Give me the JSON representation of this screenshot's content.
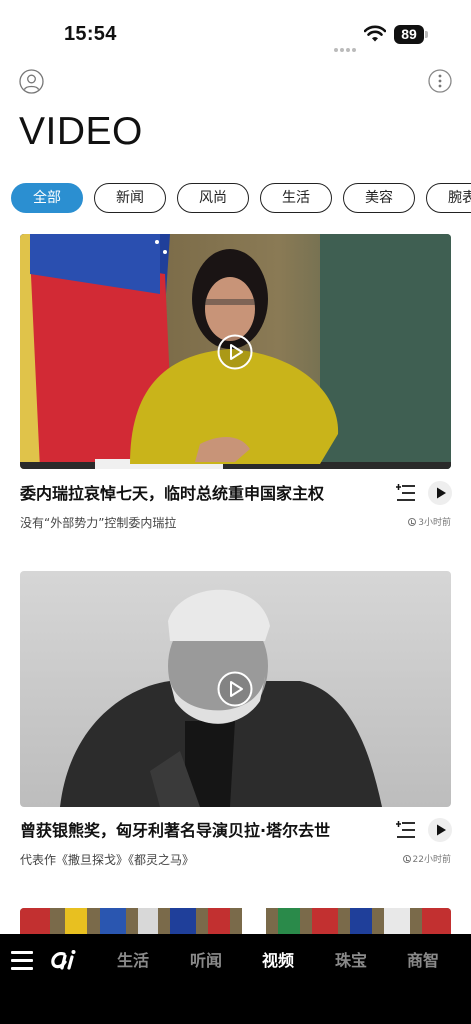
{
  "status_bar": {
    "time": "15:54",
    "battery": "89"
  },
  "header": {
    "title": "VIDEO"
  },
  "tabs": [
    {
      "label": "全部",
      "active": true
    },
    {
      "label": "新闻",
      "active": false
    },
    {
      "label": "风尚",
      "active": false
    },
    {
      "label": "生活",
      "active": false
    },
    {
      "label": "美容",
      "active": false
    },
    {
      "label": "腕表",
      "active": false
    }
  ],
  "videos": [
    {
      "title": "委内瑞拉哀悼七天，临时总统重申国家主权",
      "subtitle": "没有“外部势力”控制委内瑞拉",
      "time": "3小时前"
    },
    {
      "title": "曾获银熊奖，匈牙利著名导演贝拉·塔尔去世",
      "subtitle": "代表作《撒旦探戈》《都灵之马》",
      "time": "22小时前"
    }
  ],
  "bottom_nav": {
    "items": [
      {
        "label": "生活",
        "active": false
      },
      {
        "label": "听闻",
        "active": false
      },
      {
        "label": "视频",
        "active": true
      },
      {
        "label": "珠宝",
        "active": false
      },
      {
        "label": "商智",
        "active": false
      }
    ]
  },
  "colors": {
    "accent": "#2b8fd1",
    "nav_bg": "#000000",
    "nav_inactive": "#8a8a8a"
  }
}
